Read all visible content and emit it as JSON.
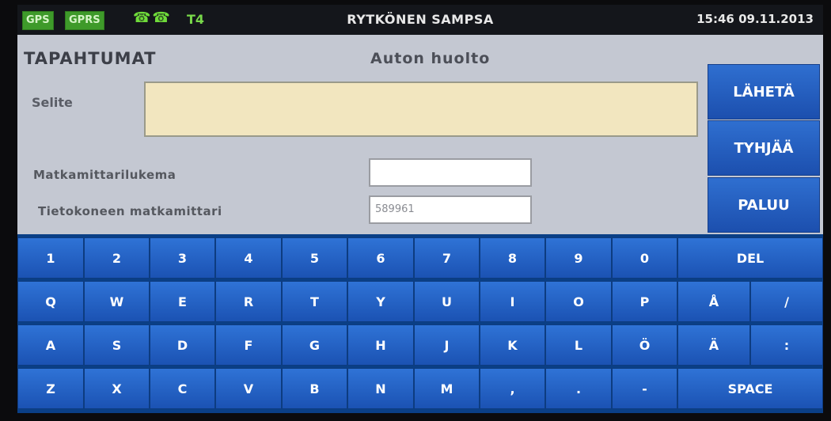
{
  "status_bar": {
    "gps": "GPS",
    "gprs": "GPRS",
    "phone_icons": "☎☎",
    "t_label": "T4",
    "driver_name": "RYTKÖNEN SAMPSA",
    "datetime": "15:46 09.11.2013"
  },
  "form": {
    "title": "TAPAHTUMAT",
    "subtitle": "Auton huolto",
    "selite_label": "Selite",
    "selite_value": "",
    "odometer_label": "Matkamittarilukema",
    "odometer_value": "",
    "computer_odometer_label": "Tietokoneen matkamittari",
    "computer_odometer_value": "589961"
  },
  "side_buttons": {
    "send": "LÄHETÄ",
    "clear": "TYHJÄÄ",
    "back": "PALUU"
  },
  "keyboard": {
    "row1": [
      "1",
      "2",
      "3",
      "4",
      "5",
      "6",
      "7",
      "8",
      "9",
      "0",
      "DEL"
    ],
    "row2": [
      "Q",
      "W",
      "E",
      "R",
      "T",
      "Y",
      "U",
      "I",
      "O",
      "P",
      "Å",
      "/"
    ],
    "row3": [
      "A",
      "S",
      "D",
      "F",
      "G",
      "H",
      "J",
      "K",
      "L",
      "Ö",
      "Ä",
      ":"
    ],
    "row4": [
      "Z",
      "X",
      "C",
      "V",
      "B",
      "N",
      "M",
      ",",
      ".",
      "-",
      "SPACE"
    ]
  },
  "colors": {
    "key_blue": "#2f73d6",
    "form_bg": "#c4c8d2",
    "text_field_yellow": "#f2e6bf"
  }
}
